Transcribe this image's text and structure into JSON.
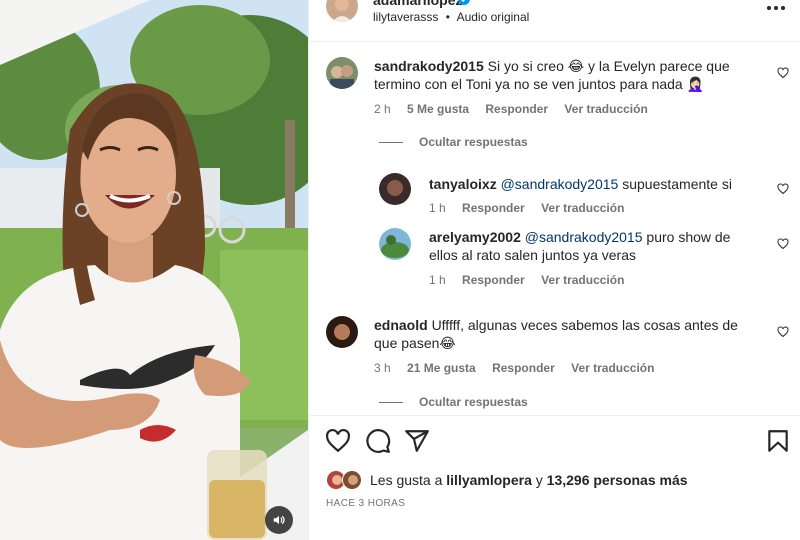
{
  "post": {
    "username": "adamarilopez",
    "audio_user": "lilytaverasss",
    "audio_label": "Audio original",
    "separator": "•"
  },
  "icons": {
    "verified": "verified-badge-icon",
    "more": "more-options-icon",
    "like": "heart-icon",
    "comment": "comment-icon",
    "share": "share-icon",
    "save": "bookmark-icon",
    "audio": "speaker-icon"
  },
  "colors": {
    "text": "#262626",
    "secondary": "#737373",
    "mention": "#00376b",
    "verified": "#0095f6",
    "divider": "#efefef"
  },
  "comments": [
    {
      "username": "sandrakody2015",
      "text": "Si yo si creo 😂 y la Evelyn parece que termino con el Toni ya no se ven juntos para nada 🤦🏻‍♀️",
      "time": "2 h",
      "likes": "5 Me gusta",
      "reply": "Responder",
      "translate": "Ver traducción",
      "hide_replies": "Ocultar respuestas",
      "replies": [
        {
          "username": "tanyaloixz",
          "mention": "@sandrakody2015",
          "text": "supuestamente si",
          "time": "1 h",
          "reply": "Responder",
          "translate": "Ver traducción"
        },
        {
          "username": "arelyamy2002",
          "mention": "@sandrakody2015",
          "text": "puro show de ellos al rato salen juntos ya veras",
          "time": "1 h",
          "reply": "Responder",
          "translate": "Ver traducción"
        }
      ]
    },
    {
      "username": "ednaold",
      "text": "Ufffff, algunas veces sabemos las cosas antes de que pasen😂",
      "time": "3 h",
      "likes": "21 Me gusta",
      "reply": "Responder",
      "translate": "Ver traducción",
      "hide_replies": "Ocultar respuestas"
    }
  ],
  "likes_line": {
    "prefix": "Les gusta a",
    "user": "lillyamlopera",
    "connector": "y",
    "others": "13,296 personas más"
  },
  "timestamp": "HACE 3 HORAS"
}
